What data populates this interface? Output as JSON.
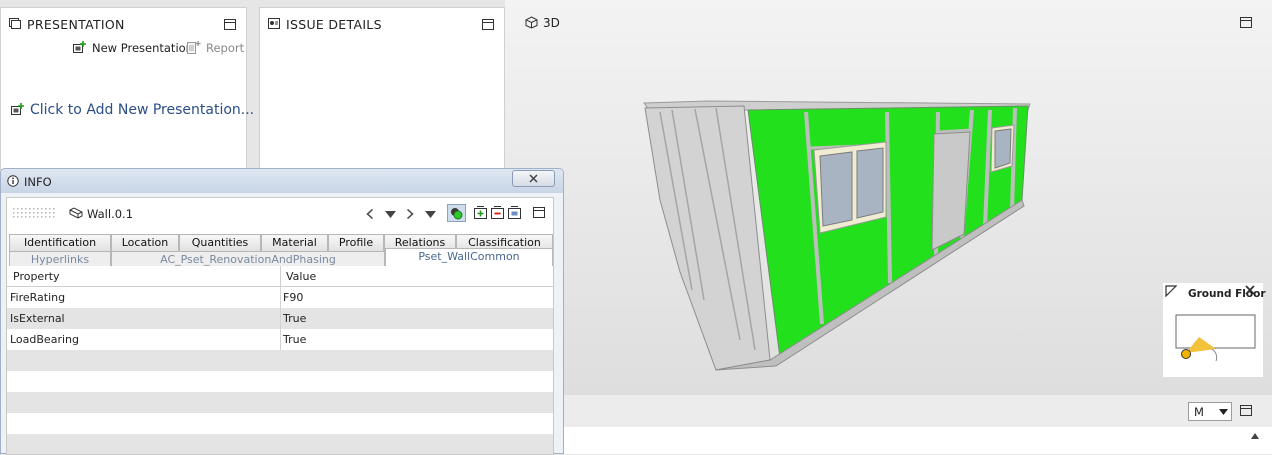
{
  "presentation": {
    "title": "PRESENTATION",
    "new_label": "New Presentation",
    "report_label": "Report",
    "add_link": "Click to Add New Presentation..."
  },
  "issue_details": {
    "title": "ISSUE DETAILS"
  },
  "viewport": {
    "label": "3D"
  },
  "ground_floor": {
    "title": "Ground Floor"
  },
  "status": {
    "mode_value": "M"
  },
  "info": {
    "title": "INFO",
    "element_name": "Wall.0.1",
    "tabs_row1": [
      "Identification",
      "Location",
      "Quantities",
      "Material",
      "Profile",
      "Relations",
      "Classification"
    ],
    "tabs_row2": [
      "Hyperlinks",
      "AC_Pset_RenovationAndPhasing",
      "Pset_WallCommon"
    ],
    "columns": [
      "Property",
      "Value"
    ],
    "rows": [
      {
        "property": "FireRating",
        "value": "F90"
      },
      {
        "property": "IsExternal",
        "value": "True"
      },
      {
        "property": "LoadBearing",
        "value": "True"
      }
    ]
  },
  "colors": {
    "wall_green": "#22e01c",
    "link_blue": "#2a4f86",
    "tab_active_text": "#4a6790"
  }
}
